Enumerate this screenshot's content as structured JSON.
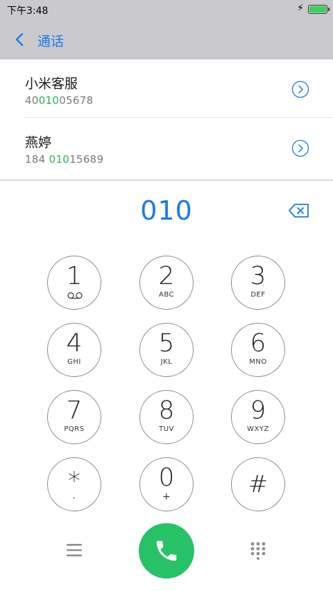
{
  "status_bar": {
    "time": "下午3:48",
    "charging_icon": "bolt-icon",
    "battery_color": "#3bd25b"
  },
  "header": {
    "back_icon": "chevron-left-icon",
    "title": "通话",
    "accent_color": "#1a7ae6"
  },
  "contacts": [
    {
      "name": "小米客服",
      "number_prefix": "40",
      "number_match": "010",
      "number_suffix": "05678",
      "info_icon": "chevron-right-circle-icon"
    },
    {
      "name": "燕婷",
      "number_prefix": "184 ",
      "number_match": "010",
      "number_suffix": "15689",
      "info_icon": "chevron-right-circle-icon"
    }
  ],
  "dialer": {
    "dialed_number": "010",
    "delete_icon": "backspace-icon",
    "keys": [
      {
        "digit": "1",
        "letters": "",
        "icon": "voicemail-icon"
      },
      {
        "digit": "2",
        "letters": "ABC"
      },
      {
        "digit": "3",
        "letters": "DEF"
      },
      {
        "digit": "4",
        "letters": "GHI"
      },
      {
        "digit": "5",
        "letters": "JKL"
      },
      {
        "digit": "6",
        "letters": "MNO"
      },
      {
        "digit": "7",
        "letters": "PQRS"
      },
      {
        "digit": "8",
        "letters": "TUV"
      },
      {
        "digit": "9",
        "letters": "WXYZ"
      },
      {
        "digit": "*",
        "letters": ","
      },
      {
        "digit": "0",
        "letters": "+"
      },
      {
        "digit": "#",
        "letters": ""
      }
    ]
  },
  "bottom_bar": {
    "menu_icon": "menu-icon",
    "call_icon": "phone-icon",
    "call_color": "#27c266",
    "keypad_icon": "keypad-icon"
  }
}
